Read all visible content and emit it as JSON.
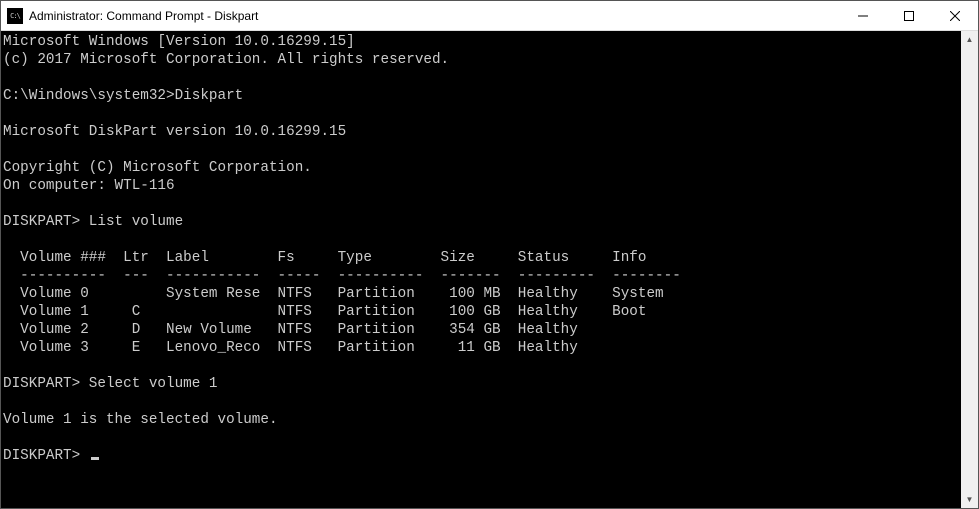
{
  "window": {
    "title": "Administrator: Command Prompt - Diskpart",
    "icon_label": "C:\\"
  },
  "terminal": {
    "line1": "Microsoft Windows [Version 10.0.16299.15]",
    "line2": "(c) 2017 Microsoft Corporation. All rights reserved.",
    "blank1": "",
    "prompt1": "C:\\Windows\\system32>Diskpart",
    "blank2": "",
    "dpver": "Microsoft DiskPart version 10.0.16299.15",
    "blank3": "",
    "copyright": "Copyright (C) Microsoft Corporation.",
    "computer": "On computer: WTL-116",
    "blank4": "",
    "dp_cmd1": "DISKPART> List volume",
    "blank5": "",
    "tbl_header": "  Volume ###  Ltr  Label        Fs     Type        Size     Status     Info",
    "tbl_divider": "  ----------  ---  -----------  -----  ----------  -------  ---------  --------",
    "vol0": "  Volume 0         System Rese  NTFS   Partition    100 MB  Healthy    System",
    "vol1": "  Volume 1     C                NTFS   Partition    100 GB  Healthy    Boot",
    "vol2": "  Volume 2     D   New Volume   NTFS   Partition    354 GB  Healthy",
    "vol3": "  Volume 3     E   Lenovo_Reco  NTFS   Partition     11 GB  Healthy",
    "blank6": "",
    "dp_cmd2": "DISKPART> Select volume 1",
    "blank7": "",
    "selected": "Volume 1 is the selected volume.",
    "blank8": "",
    "dp_prompt": "DISKPART> "
  }
}
